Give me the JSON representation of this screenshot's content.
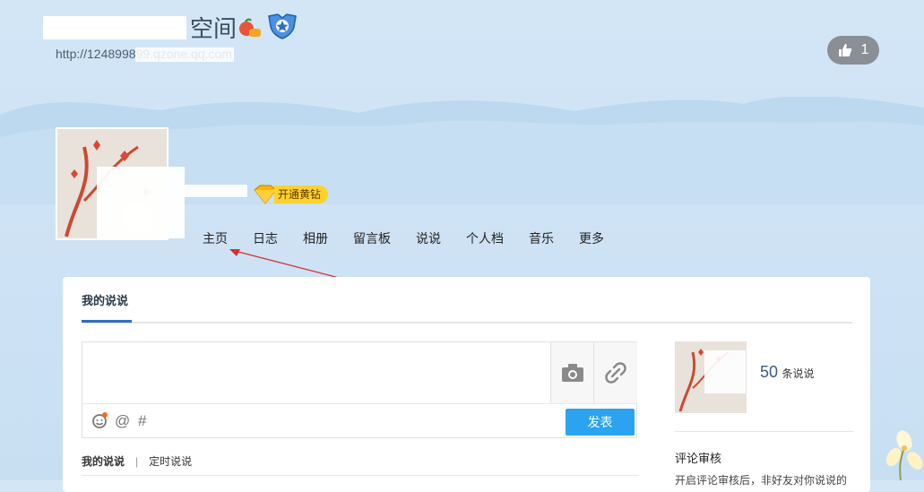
{
  "header": {
    "title_visible_chars": "空间",
    "url": "http://124899899.qzone.qq.com",
    "like_count": "1",
    "vip_label": "开通黄钻"
  },
  "nav": {
    "items": [
      "主页",
      "日志",
      "相册",
      "留言板",
      "说说",
      "个人档",
      "音乐",
      "更多"
    ]
  },
  "panel": {
    "tab_label": "我的说说",
    "post_button": "发表",
    "subtabs": [
      "我的说说",
      "定时说说"
    ],
    "subtab_separator": "|",
    "shuoshuo_count": "50",
    "shuoshuo_unit": "条说说",
    "review_title": "评论审核",
    "review_text": "开启评论审核后，非好友对你说说的"
  },
  "icons": {
    "camera": "camera-icon",
    "link": "link-icon",
    "emoji": "emoji-icon",
    "mention": "at-icon",
    "topic": "hash-icon",
    "like": "thumbs-up-icon"
  },
  "colors": {
    "accent_blue": "#2ca3f0",
    "tab_underline": "#2e6dc7",
    "vip_gold": "#ffd12b"
  }
}
